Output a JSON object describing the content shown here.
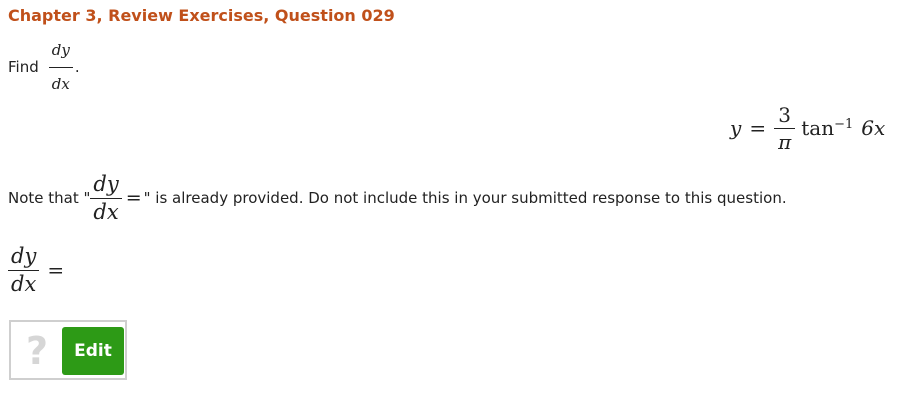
{
  "header": {
    "title": "Chapter 3, Review Exercises, Question 029"
  },
  "prompt": {
    "find_word": "Find",
    "deriv_num": "dy",
    "deriv_den": "dx",
    "period": "."
  },
  "equation": {
    "lhs": "y",
    "eq": "=",
    "coef_num": "3",
    "coef_den": "π",
    "func": "tan",
    "exponent": "−1",
    "arg": "6x"
  },
  "note": {
    "prefix": "Note that \"",
    "deriv_num": "dy",
    "deriv_den": "dx",
    "eq": "=",
    "suffix": "\" is already provided. Do not include this in your submitted response to this question."
  },
  "answer": {
    "deriv_num": "dy",
    "deriv_den": "dx",
    "eq": "="
  },
  "editor": {
    "placeholder_icon": "?",
    "edit_label": "Edit",
    "edit_color": "#2d9a16"
  },
  "colors": {
    "title": "#c0501a"
  }
}
